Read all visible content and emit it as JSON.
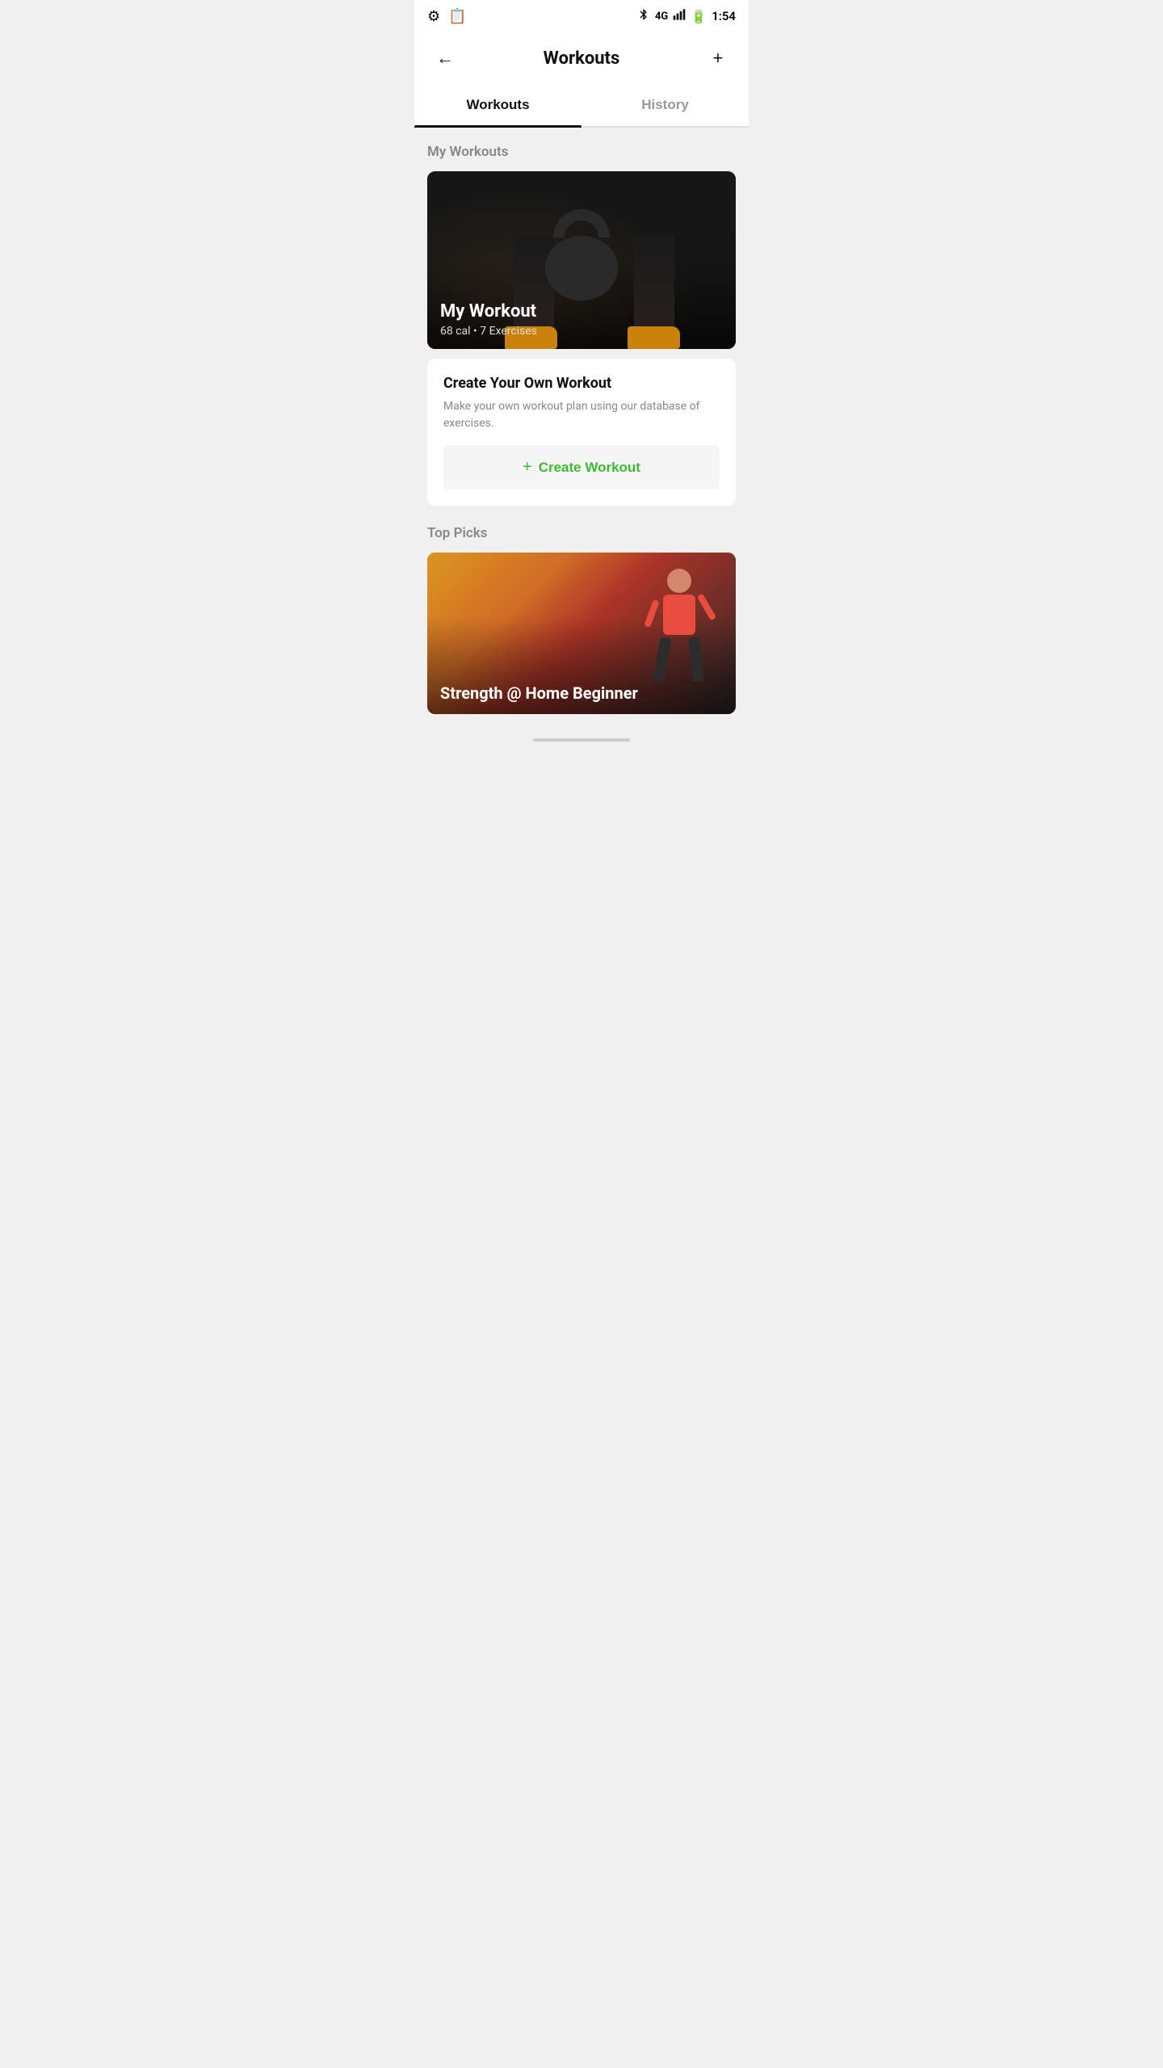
{
  "statusBar": {
    "time": "1:54",
    "icons": {
      "settings": "⚙",
      "clipboard": "📋",
      "bluetooth": "bluetooth-icon",
      "signal": "4G",
      "battery": "⚡"
    }
  },
  "topBar": {
    "title": "Workouts",
    "backLabel": "←",
    "addLabel": "+"
  },
  "tabs": [
    {
      "id": "workouts",
      "label": "Workouts",
      "active": true
    },
    {
      "id": "history",
      "label": "History",
      "active": false
    }
  ],
  "myWorkoutsSection": {
    "label": "My Workouts",
    "card": {
      "name": "My Workout",
      "calories": "68 cal",
      "dot": "•",
      "exercises": "7 Exercises"
    }
  },
  "createWorkout": {
    "title": "Create Your Own Workout",
    "description": "Make your own workout plan using our database of exercises.",
    "buttonLabel": "+ Create Workout",
    "buttonPlus": "+",
    "buttonText": "Create Workout"
  },
  "topPicksSection": {
    "label": "Top Picks",
    "card": {
      "name": "Strength @ Home Beginner"
    }
  }
}
